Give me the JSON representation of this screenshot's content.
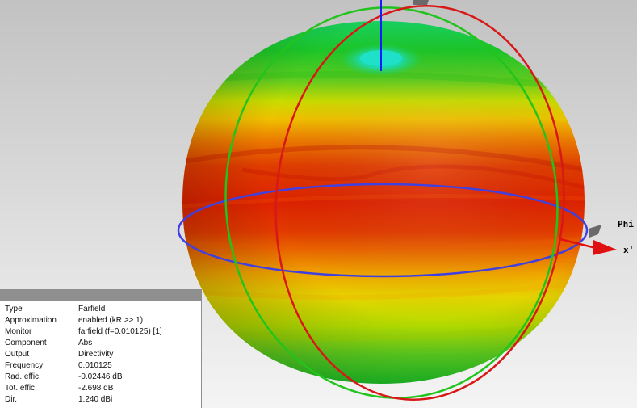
{
  "axes": {
    "phi_label": "Phi",
    "x_label": "x'"
  },
  "colors": {
    "pattern_high": "#de2000",
    "pattern_mid": "#e9d800",
    "pattern_low": "#24c820",
    "pattern_min": "#1de0b8",
    "theta_circle": "#d81818",
    "phi_circle": "#22c41c",
    "horizon_circle": "#4040e0",
    "z_axis": "#1a1aff",
    "x_axis": "#e01010"
  },
  "info": {
    "rows": [
      {
        "key": "Type",
        "value": "Farfield"
      },
      {
        "key": "Approximation",
        "value": "enabled (kR >> 1)"
      },
      {
        "key": "Monitor",
        "value": "farfield (f=0.010125) [1]"
      },
      {
        "key": "Component",
        "value": "Abs"
      },
      {
        "key": "Output",
        "value": "Directivity"
      },
      {
        "key": "Frequency",
        "value": "0.010125"
      },
      {
        "key": "Rad. effic.",
        "value": "-0.02446 dB"
      },
      {
        "key": "Tot. effic.",
        "value": "-2.698 dB"
      },
      {
        "key": "Dir.",
        "value": "1.240 dBi"
      }
    ]
  }
}
